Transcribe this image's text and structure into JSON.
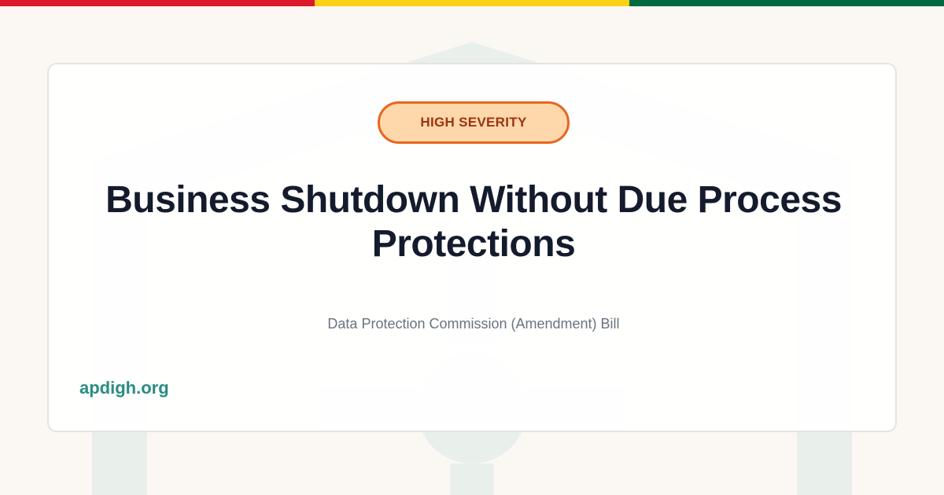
{
  "flag_colors": [
    "#dc1a2b",
    "#fcd116",
    "#006b3f"
  ],
  "badge": {
    "label": "HIGH SEVERITY",
    "text_color": "#9a3412",
    "bg_color": "#fed7aa",
    "border_color": "#e8651f"
  },
  "title": "Business Shutdown Without Due Process Protections",
  "title_color": "#141b2d",
  "subtitle": "Data Protection Commission (Amendment) Bill",
  "subtitle_color": "#6b7280",
  "site": "apdigh.org",
  "site_color": "#2a8c84",
  "watermark_color": "#e9efeb",
  "watermark_icon": "house-with-crosshair-icon"
}
